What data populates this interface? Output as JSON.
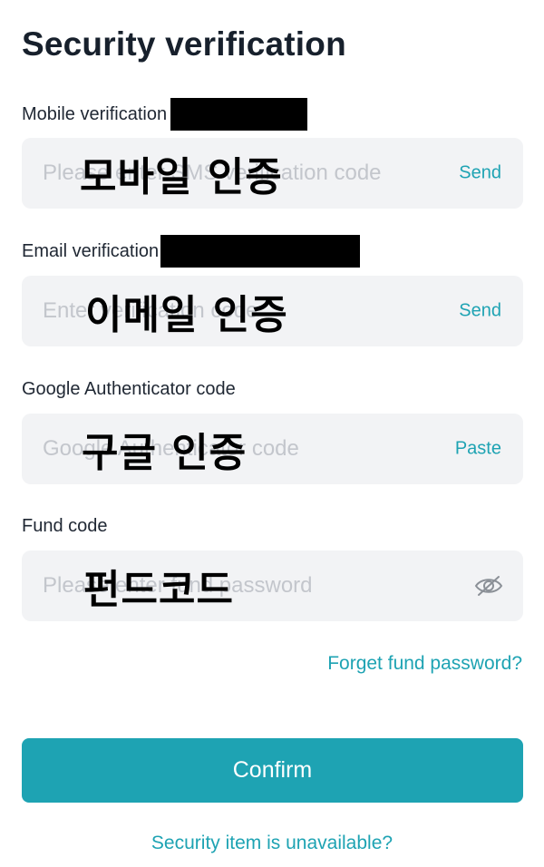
{
  "page": {
    "title": "Security verification"
  },
  "fields": [
    {
      "label": "Mobile verification",
      "placeholder": "Please enter SMS verification code",
      "overlay": "모바일 인증",
      "action": "Send"
    },
    {
      "label": "Email verification",
      "placeholder": "Enter verification code",
      "overlay": "이메일 인증",
      "action": "Send"
    },
    {
      "label": "Google Authenticator code",
      "placeholder": "Google Authenticator code",
      "overlay": "구글 인증",
      "action": "Paste"
    },
    {
      "label": "Fund code",
      "placeholder": "Please enter fund password",
      "overlay": "펀드코드",
      "action_icon": "eye-off-icon"
    }
  ],
  "links": {
    "forget_fund_password": "Forget fund password?",
    "security_unavailable": "Security item is unavailable?"
  },
  "buttons": {
    "confirm": "Confirm"
  },
  "colors": {
    "accent": "#1ea3b3",
    "field_bg": "#f2f3f5",
    "placeholder": "#c3c6cc"
  }
}
